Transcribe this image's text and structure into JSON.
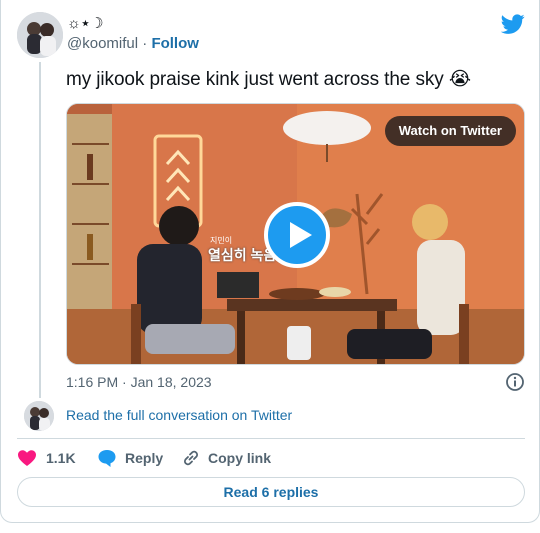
{
  "author": {
    "display_name": "☼⋆☽",
    "handle": "@koomiful",
    "separator": "·",
    "follow_label": "Follow"
  },
  "tweet": {
    "text": "my jikook praise kink just went across the sky 😭",
    "time": "1:16 PM",
    "date_separator": "·",
    "date": "Jan 18, 2023"
  },
  "media": {
    "watch_label": "Watch on Twitter",
    "subtitle_small": "지민이",
    "subtitle": "열심히 녹음했"
  },
  "conversation_link": "Read the full conversation on Twitter",
  "actions": {
    "like_count": "1.1K",
    "reply_label": "Reply",
    "copy_label": "Copy link"
  },
  "read_replies_label": "Read 6 replies",
  "colors": {
    "accent": "#1d9bf0",
    "link": "#1d6fa8",
    "like": "#f91880",
    "border": "#cfd9de",
    "muted": "#536471"
  }
}
